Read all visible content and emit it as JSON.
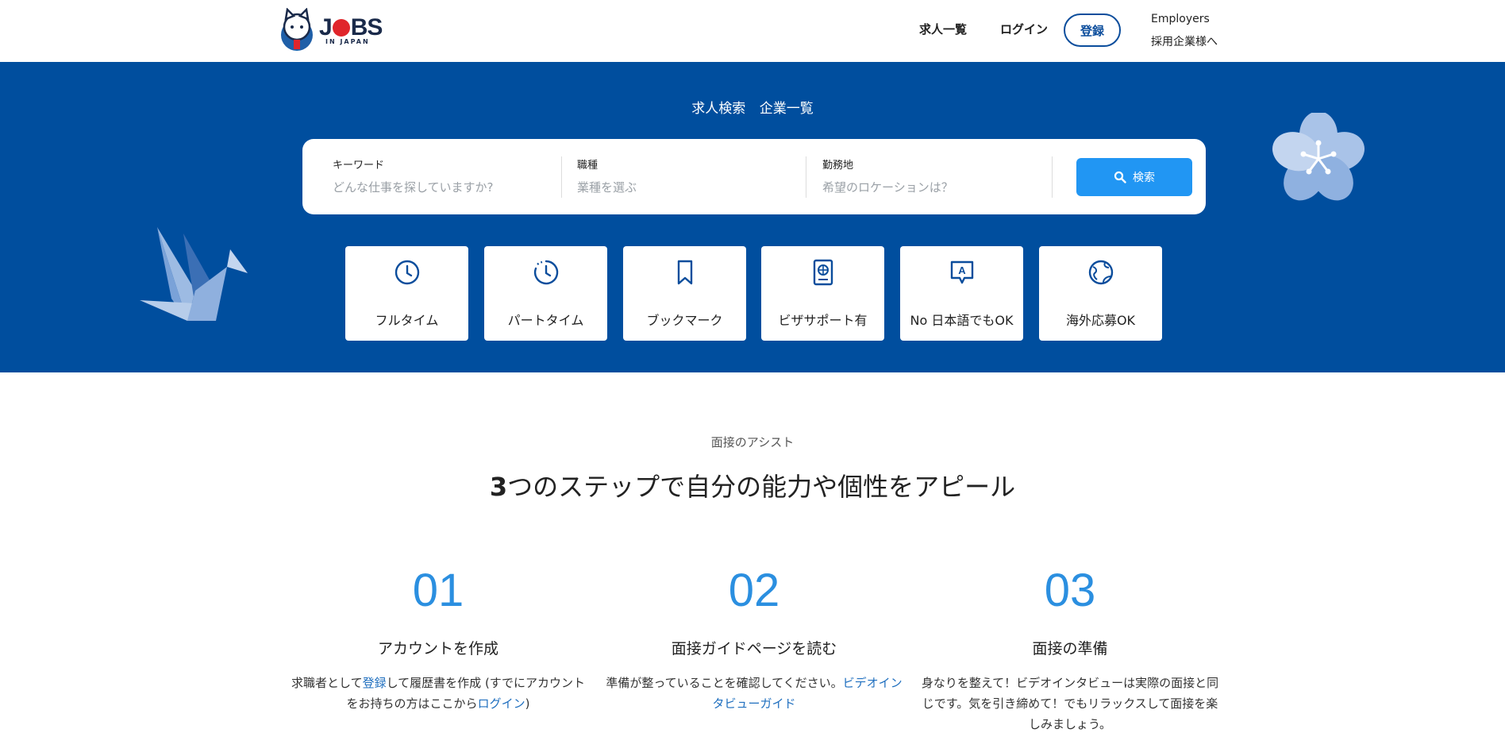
{
  "header": {
    "logo_main": "JOBS",
    "logo_sub": "IN JAPAN",
    "nav": {
      "jobs": "求人一覧",
      "login": "ログイン",
      "register": "登録",
      "employers_en": "Employers",
      "employers_ja": "採用企業様へ"
    }
  },
  "hero": {
    "tabs": [
      "求人検索",
      "企業一覧"
    ],
    "search": {
      "keyword_label": "キーワード",
      "keyword_placeholder": "どんな仕事を探していますか?",
      "occupation_label": "職種",
      "occupation_placeholder": "業種を選ぶ",
      "location_label": "勤務地",
      "location_placeholder": "希望のロケーションは？",
      "button": "検索"
    },
    "categories": [
      {
        "label": "フルタイム",
        "icon": "clock-icon"
      },
      {
        "label": "パートタイム",
        "icon": "part-time-clock-icon"
      },
      {
        "label": "ブックマーク",
        "icon": "bookmark-icon"
      },
      {
        "label": "ビザサポート有",
        "icon": "passport-icon"
      },
      {
        "label": "No 日本語でもOK",
        "icon": "speech-bubble-a-icon"
      },
      {
        "label": "海外応募OK",
        "icon": "globe-icon"
      }
    ],
    "colors": {
      "background": "#004e9e",
      "search_button": "#2196f3"
    }
  },
  "steps_section": {
    "eyebrow": "面接のアシスト",
    "headline_num": "3",
    "headline_rest": "つのステップで自分の能力や個性をアピール",
    "steps": [
      {
        "num": "01",
        "title": "アカウントを作成",
        "desc_pre": "求職者として",
        "desc_link1": "登録",
        "desc_mid": "して履歴書を作成 (すでにアカウントをお持ちの方はここから",
        "desc_link2": "ログイン",
        "desc_post": ")"
      },
      {
        "num": "02",
        "title": "面接ガイドページを読む",
        "desc_pre": "準備が整っていることを確認してください。",
        "desc_link1": "ビデオインタビューガイド"
      },
      {
        "num": "03",
        "title": "面接の準備",
        "desc": "身なりを整えて！ビデオインタビューは実際の面接と同じです。気を引き締めて！でもリラックスして面接を楽しみましょう。"
      }
    ],
    "accent_color": "#2b8fe0"
  }
}
